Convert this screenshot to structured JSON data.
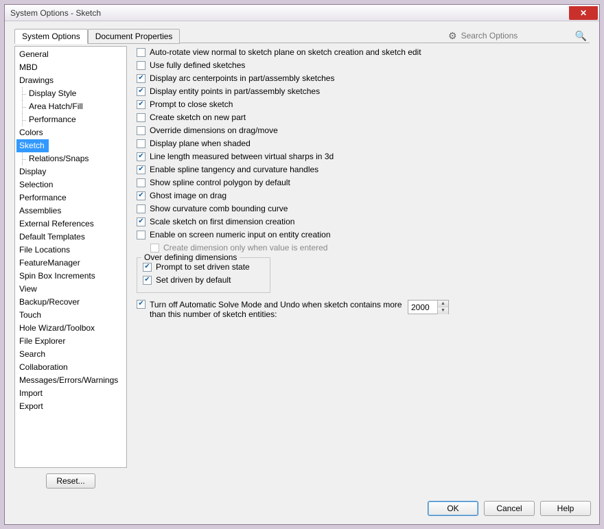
{
  "window": {
    "title": "System Options - Sketch"
  },
  "tabs": {
    "system": "System Options",
    "document": "Document Properties"
  },
  "search": {
    "placeholder": "Search Options"
  },
  "tree": [
    {
      "label": "General"
    },
    {
      "label": "MBD"
    },
    {
      "label": "Drawings"
    },
    {
      "label": "Display Style",
      "child": true
    },
    {
      "label": "Area Hatch/Fill",
      "child": true
    },
    {
      "label": "Performance",
      "child": true
    },
    {
      "label": "Colors"
    },
    {
      "label": "Sketch",
      "selected": true
    },
    {
      "label": "Relations/Snaps",
      "child": true
    },
    {
      "label": "Display"
    },
    {
      "label": "Selection"
    },
    {
      "label": "Performance"
    },
    {
      "label": "Assemblies"
    },
    {
      "label": "External References"
    },
    {
      "label": "Default Templates"
    },
    {
      "label": "File Locations"
    },
    {
      "label": "FeatureManager"
    },
    {
      "label": "Spin Box Increments"
    },
    {
      "label": "View"
    },
    {
      "label": "Backup/Recover"
    },
    {
      "label": "Touch"
    },
    {
      "label": "Hole Wizard/Toolbox"
    },
    {
      "label": "File Explorer"
    },
    {
      "label": "Search"
    },
    {
      "label": "Collaboration"
    },
    {
      "label": "Messages/Errors/Warnings"
    },
    {
      "label": "Import"
    },
    {
      "label": "Export"
    }
  ],
  "reset_label": "Reset...",
  "options": [
    {
      "label": "Auto-rotate view normal to sketch plane on sketch creation and sketch edit",
      "checked": false
    },
    {
      "label": "Use fully defined sketches",
      "checked": false
    },
    {
      "label": "Display arc centerpoints in part/assembly sketches",
      "checked": true
    },
    {
      "label": "Display entity points in part/assembly sketches",
      "checked": true
    },
    {
      "label": "Prompt to close sketch",
      "checked": true
    },
    {
      "label": "Create sketch on new part",
      "checked": false
    },
    {
      "label": "Override dimensions on drag/move",
      "checked": false
    },
    {
      "label": "Display plane when shaded",
      "checked": false
    },
    {
      "label": "Line length measured between virtual sharps in 3d",
      "checked": true
    },
    {
      "label": "Enable spline tangency and curvature handles",
      "checked": true
    },
    {
      "label": "Show spline control polygon by default",
      "checked": false
    },
    {
      "label": "Ghost image on drag",
      "checked": true
    },
    {
      "label": "Show curvature comb bounding curve",
      "checked": false
    },
    {
      "label": "Scale sketch on first dimension creation",
      "checked": true
    },
    {
      "label": "Enable on screen numeric input on entity creation",
      "checked": false
    }
  ],
  "sub_option": {
    "label": "Create dimension only when value is entered",
    "checked": false
  },
  "group": {
    "title": "Over defining dimensions",
    "items": [
      {
        "label": "Prompt to set driven state",
        "checked": true
      },
      {
        "label": "Set driven by default",
        "checked": true
      }
    ]
  },
  "entities": {
    "checked": true,
    "label": "Turn off Automatic Solve Mode and Undo when sketch contains more than this number of sketch entities:",
    "value": "2000"
  },
  "footer": {
    "ok": "OK",
    "cancel": "Cancel",
    "help": "Help"
  }
}
